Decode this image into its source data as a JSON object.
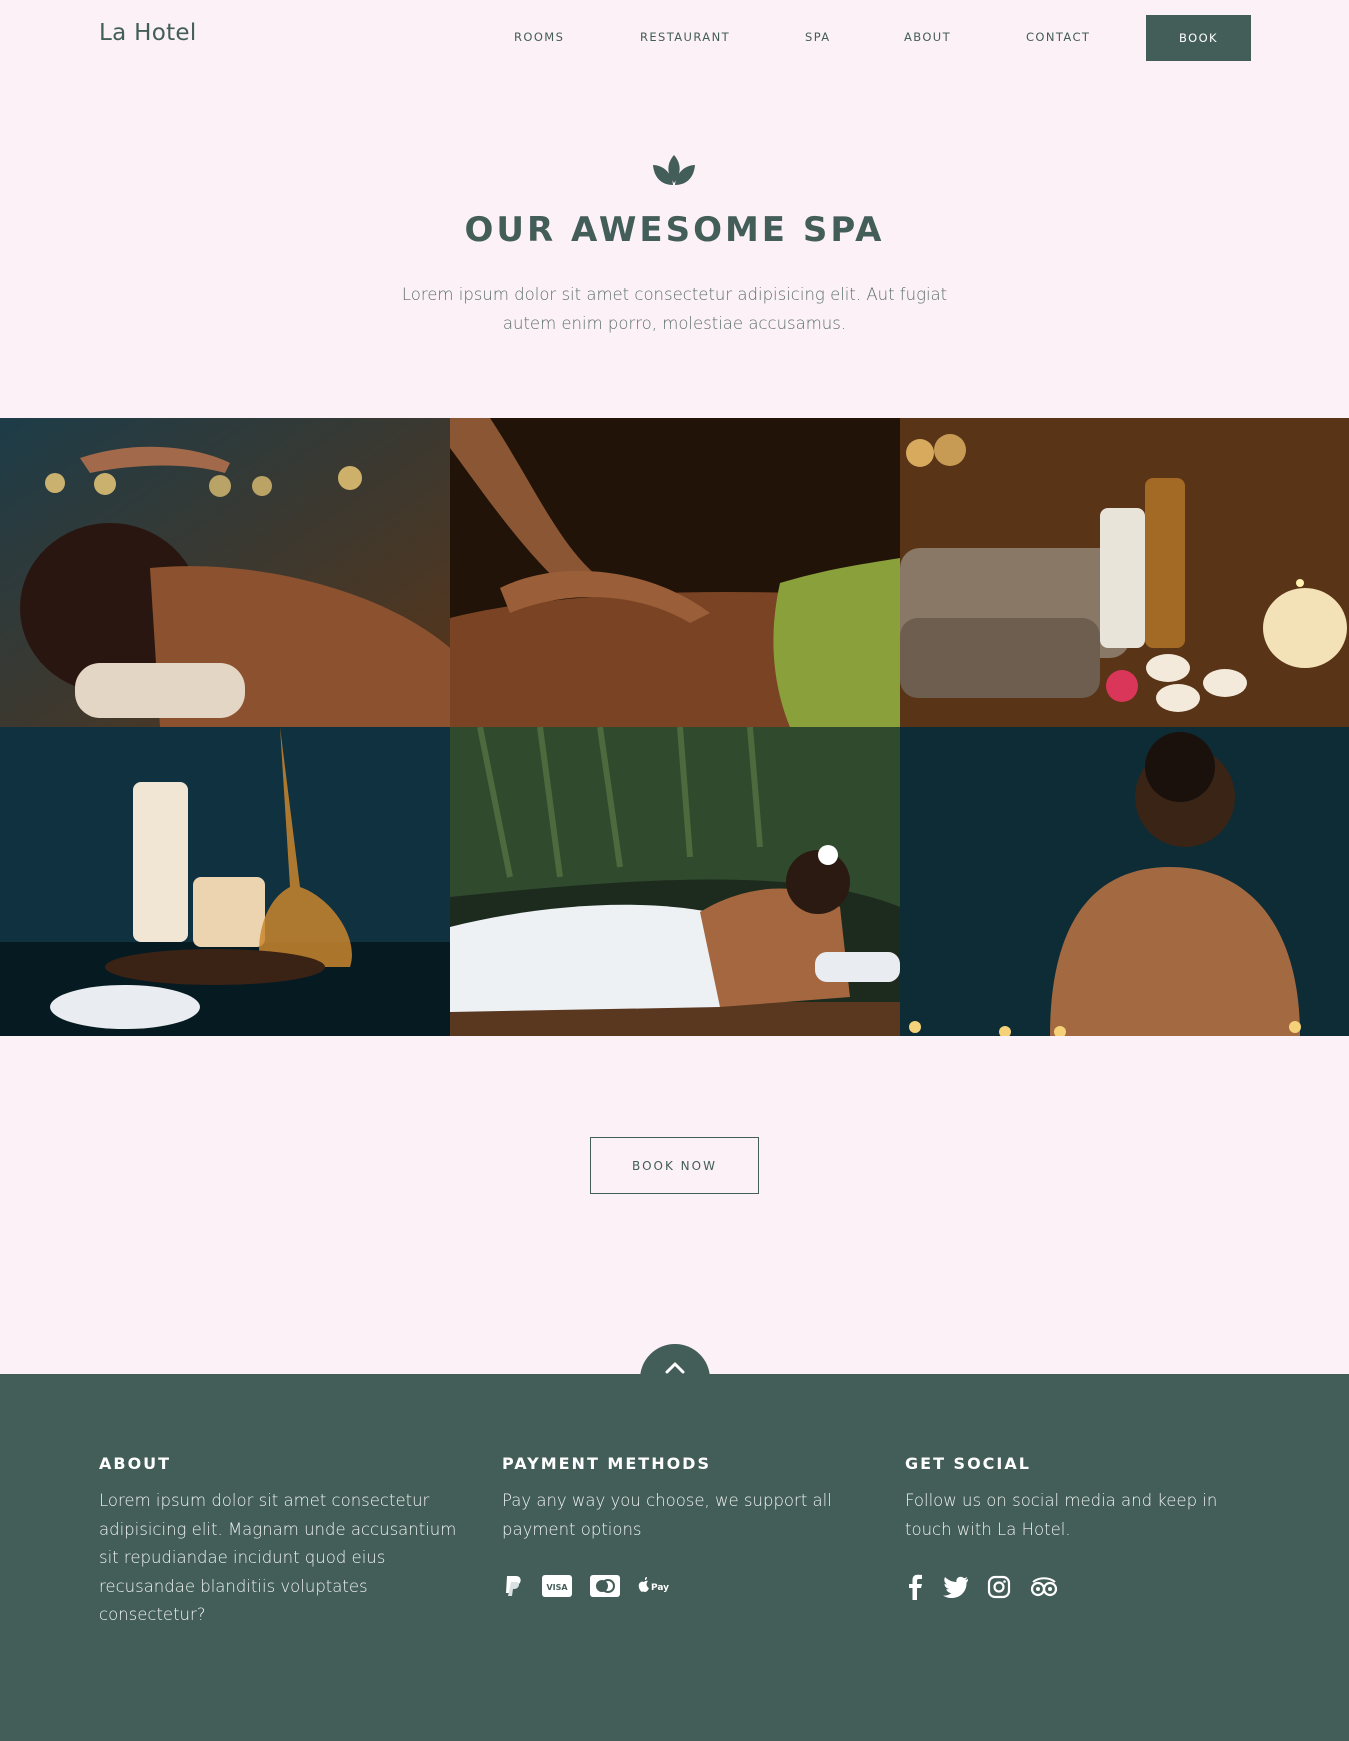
{
  "header": {
    "logo": "La Hotel",
    "nav": [
      "ROOMS",
      "RESTAURANT",
      "SPA",
      "ABOUT",
      "CONTACT"
    ],
    "book_label": "BOOK"
  },
  "hero": {
    "icon": "lotus-icon",
    "title": "OUR AWESOME SPA",
    "subtitle": "Lorem ipsum dolor sit amet consectetur adipisicing elit. Aut fugiat autem enim porro, molestiae accusamus."
  },
  "gallery": {
    "images": [
      "woman-receiving-reiki",
      "back-massage",
      "spa-products-candles",
      "candles-reed-diffuser-salt",
      "woman-relaxing-towel",
      "woman-back-shoulder"
    ]
  },
  "cta": {
    "book_now_label": "BOOK NOW"
  },
  "footer": {
    "scroll_top_icon": "chevron-up-icon",
    "about": {
      "title": "ABOUT",
      "text": "Lorem ipsum dolor sit amet consectetur adipisicing elit. Magnam unde accusantium sit repudiandae incidunt quod eius recusandae blanditiis voluptates consectetur?"
    },
    "payment": {
      "title": "PAYMENT METHODS",
      "text": "Pay any way you choose, we support all payment options",
      "icons": [
        "paypal-icon",
        "visa-icon",
        "mastercard-icon",
        "apple-pay-icon"
      ]
    },
    "social": {
      "title": "GET SOCIAL",
      "text": "Follow us on social media and keep in touch with La Hotel.",
      "icons": [
        "facebook-icon",
        "twitter-icon",
        "instagram-icon",
        "tripadvisor-icon"
      ]
    }
  },
  "colors": {
    "background": "#fcf1f6",
    "accent": "#435d58",
    "footer_text": "#eef2f1"
  }
}
